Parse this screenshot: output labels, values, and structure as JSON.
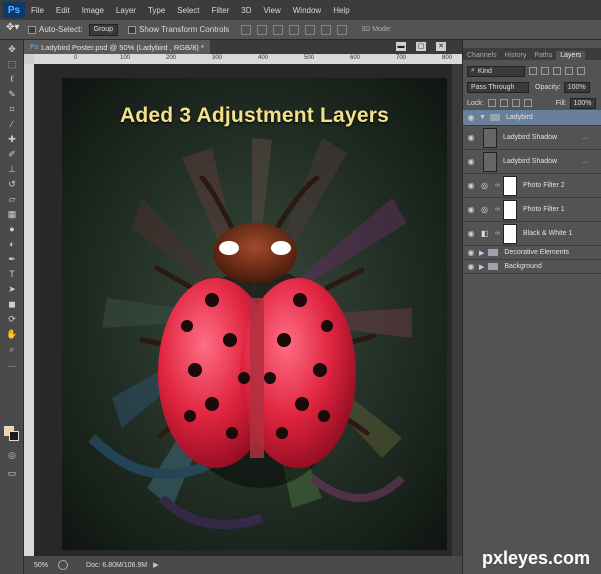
{
  "app": {
    "logo": "Ps"
  },
  "menu": [
    "File",
    "Edit",
    "Image",
    "Layer",
    "Type",
    "Select",
    "Filter",
    "3D",
    "View",
    "Window",
    "Help"
  ],
  "options": {
    "auto_select_label": "Auto-Select:",
    "auto_select_value": "Group",
    "show_transform_label": "Show Transform Controls",
    "mode_label": "3D Mode:"
  },
  "document": {
    "tab_title": "Ladybird Poster.psd @ 50% (Ladybird , RGB/8) *",
    "ruler_ticks": [
      "0",
      "100",
      "200",
      "300",
      "400",
      "500",
      "600",
      "700",
      "800"
    ],
    "zoom": "50%",
    "doc_info": "Doc: 6.80M/106.9M"
  },
  "poster": {
    "title": "Aded 3 Adjustment Layers"
  },
  "panels": {
    "tabs": [
      "Channels",
      "History",
      "Paths",
      "Layers"
    ],
    "active_tab": "Layers",
    "kind_label": "Kind",
    "blend_mode": "Pass Through",
    "opacity_label": "Opacity:",
    "opacity_value": "100%",
    "lock_label": "Lock:",
    "fill_label": "Fill:",
    "fill_value": "100%"
  },
  "layers": [
    {
      "name": "Ladybird",
      "type": "group-open",
      "selected": true
    },
    {
      "name": "Ladybird  Shadow",
      "type": "pixel",
      "fx": "..."
    },
    {
      "name": "Ladybird  Shadow",
      "type": "pixel",
      "fx": "..."
    },
    {
      "name": "Photo Filter 2",
      "type": "adjustment"
    },
    {
      "name": "Photo Filter 1",
      "type": "adjustment"
    },
    {
      "name": "Black & White 1",
      "type": "adjustment"
    },
    {
      "name": "Decorative Elements",
      "type": "group"
    },
    {
      "name": "Background",
      "type": "group"
    }
  ],
  "watermark": "pxleyes.com",
  "colors": {
    "foreground": "#f4d2a2",
    "background": "#1a1a1a",
    "title": "#f3e08a",
    "ladybird_red": "#e0243f"
  }
}
